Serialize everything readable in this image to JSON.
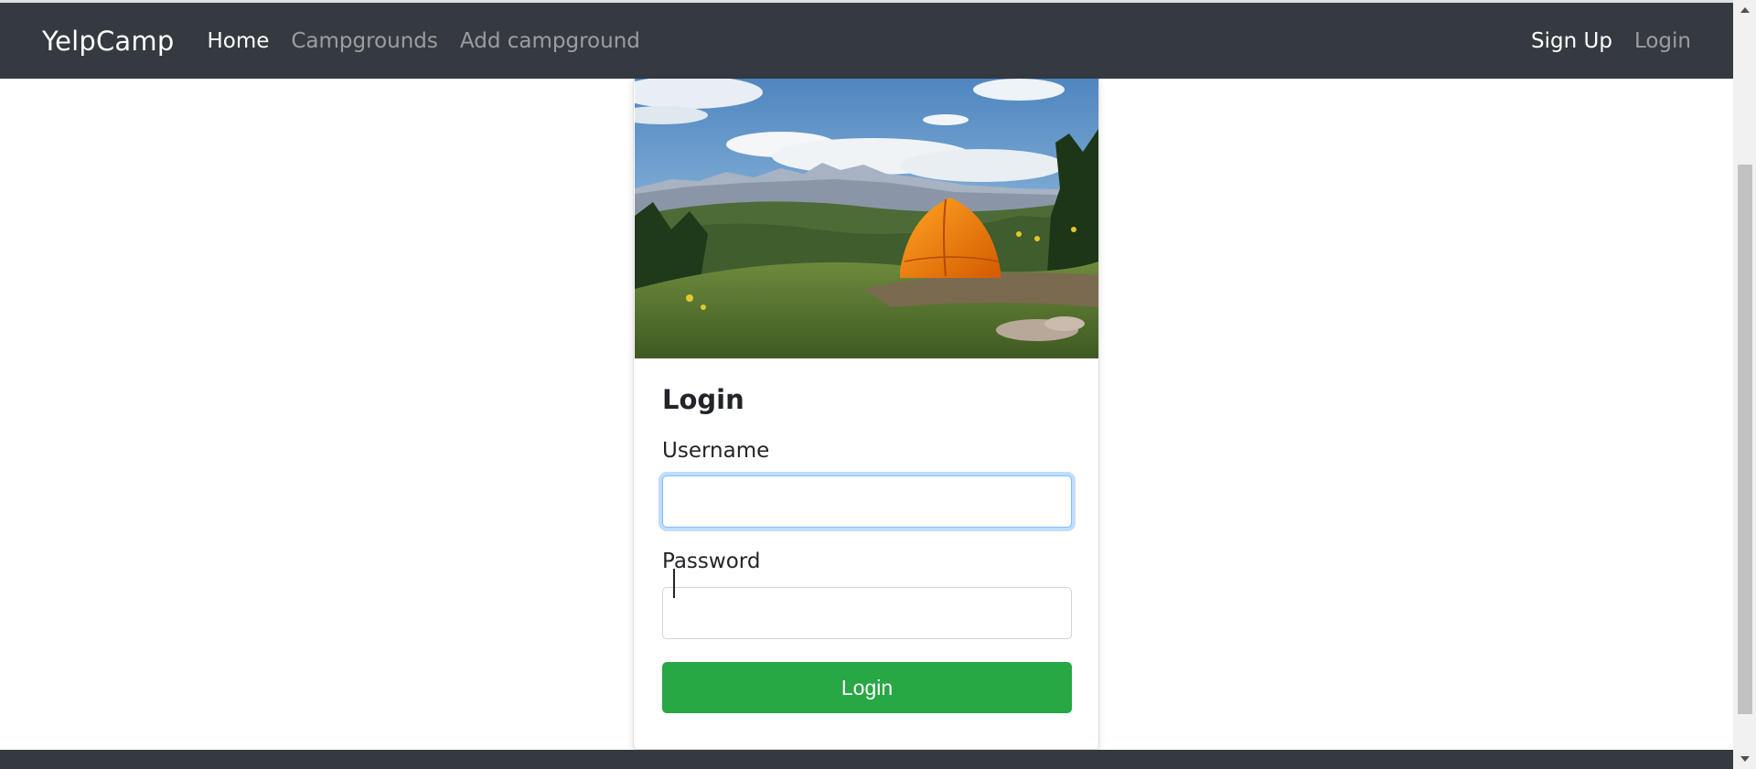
{
  "navbar": {
    "brand": "YelpCamp",
    "links": [
      {
        "label": "Home",
        "active": true
      },
      {
        "label": "Campgrounds",
        "active": false
      },
      {
        "label": "Add campground",
        "active": false
      }
    ],
    "right_links": [
      {
        "label": "Sign Up"
      },
      {
        "label": "Login"
      }
    ]
  },
  "card": {
    "image_description": "campsite-image",
    "title": "Login",
    "username": {
      "label": "Username",
      "value": "",
      "placeholder": ""
    },
    "password": {
      "label": "Password",
      "value": "",
      "placeholder": ""
    },
    "submit_label": "Login"
  },
  "colors": {
    "navbar_bg": "#343a40",
    "button_green": "#28a745",
    "focus_border": "#80bdff"
  }
}
